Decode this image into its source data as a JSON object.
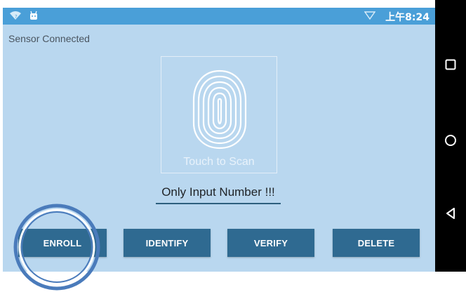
{
  "status_bar": {
    "time": "上午8:24"
  },
  "sensor": {
    "status": "Sensor Connected"
  },
  "scanner": {
    "prompt": "Touch to Scan"
  },
  "input": {
    "value": "Only Input Number !!!"
  },
  "buttons": {
    "enroll": "ENROLL",
    "identify": "IDENTIFY",
    "verify": "VERIFY",
    "delete": "DELETE"
  },
  "colors": {
    "screen_bg": "#b9d7ef",
    "status_bar": "#4a9fd8",
    "button": "#2f6a91",
    "nav_bar": "#000000"
  },
  "icons": [
    "wifi-icon",
    "android-icon",
    "signal-icon",
    "fingerprint-icon",
    "recent-apps-icon",
    "home-icon",
    "back-icon"
  ]
}
